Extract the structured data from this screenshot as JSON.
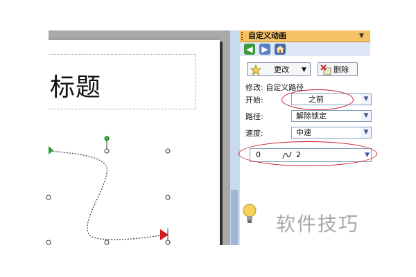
{
  "slide": {
    "title_placeholder": "标题"
  },
  "pane": {
    "title": "自定义动画",
    "menu_arrow": "▼",
    "nav": {
      "back_icon": "back-arrow-icon",
      "forward_icon": "forward-arrow-icon",
      "home_icon": "home-icon"
    },
    "change_button": "更改",
    "remove_button": "删除",
    "modify_label": "修改: 自定义路径",
    "start_label": "开始:",
    "start_value": "之前",
    "path_label": "路径:",
    "path_value": "解除锁定",
    "speed_label": "速度:",
    "speed_value": "中速",
    "list_item": {
      "index": "0",
      "name": "2"
    }
  },
  "watermark": "软件技巧",
  "colors": {
    "header_bg": "#f4c262",
    "annotation_red": "#c8192e",
    "path_start_green": "#2a9d2a",
    "path_end_red": "#d01c1c"
  }
}
